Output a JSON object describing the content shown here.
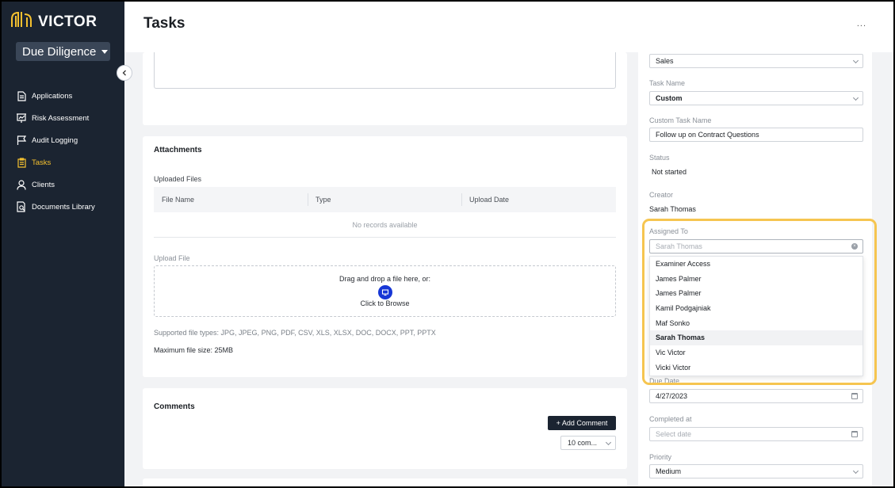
{
  "app": {
    "logo_text": "VICTOR",
    "module": "Due Diligence"
  },
  "nav": [
    {
      "label": "Applications",
      "icon": "document-icon",
      "active": false
    },
    {
      "label": "Risk Assessment",
      "icon": "presentation-chart-icon",
      "active": false
    },
    {
      "label": "Audit Logging",
      "icon": "flag-icon",
      "active": false
    },
    {
      "label": "Tasks",
      "icon": "clipboard-icon",
      "active": true
    },
    {
      "label": "Clients",
      "icon": "user-icon",
      "active": false
    },
    {
      "label": "Documents Library",
      "icon": "document-search-icon",
      "active": false
    }
  ],
  "header": {
    "title": "Tasks",
    "more": "..."
  },
  "attachments": {
    "title": "Attachments",
    "uploaded_label": "Uploaded Files",
    "columns": [
      "File Name",
      "Type",
      "Upload Date"
    ],
    "empty": "No records available",
    "upload_label": "Upload File",
    "drop_text": "Drag and drop a file here, or:",
    "browse_text": "Click to Browse",
    "types": "Supported file types: JPG, JPEG, PNG, PDF, CSV, XLS, XLSX, DOC, DOCX, PPT, PPTX",
    "max_size": "Maximum file size: 25MB"
  },
  "comments": {
    "title": "Comments",
    "add_label": "+ Add Comment",
    "count_select": "10 com..."
  },
  "details": {
    "category_value": "Sales",
    "task_name_label": "Task Name",
    "task_name_value": "Custom",
    "custom_name_label": "Custom Task Name",
    "custom_name_value": "Follow up on Contract Questions",
    "status_label": "Status",
    "status_value": "Not started",
    "creator_label": "Creator",
    "creator_value": "Sarah Thomas",
    "assigned_label": "Assigned To",
    "assigned_placeholder": "Sarah Thomas",
    "assignee_options": [
      "Examiner Access",
      "James Palmer",
      "James Palmer",
      "Kamil Podgajniak",
      "Maf Sonko",
      "Sarah Thomas",
      "Vic Victor",
      "Vicki Victor"
    ],
    "selected_option": "Sarah Thomas",
    "due_label": "Due Date",
    "due_value": "4/27/2023",
    "completed_label": "Completed at",
    "completed_placeholder": "Select date",
    "priority_label": "Priority",
    "priority_value": "Medium"
  },
  "colors": {
    "sidebar": "#1b2431",
    "accent": "#f4c02f",
    "highlight": "#f6c550",
    "browse_icon": "#1737d6"
  }
}
